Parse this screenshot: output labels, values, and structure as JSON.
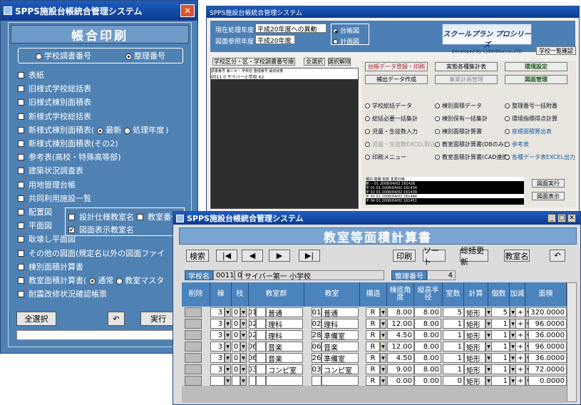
{
  "win1": {
    "title": "SPPS施設台帳統合管理システム",
    "heading": "帳合印刷",
    "radio": [
      {
        "label": "学校調書番号",
        "selected": false
      },
      {
        "label": "整理番号",
        "selected": true
      }
    ],
    "items": [
      "表紙",
      "旧様式学校総括表",
      "旧様式棟別面積表",
      "新様式学校総括表",
      "新様式棟別面積表(",
      "新様式棟別面積表(その2)",
      "参考表(高校・特殊高等部)",
      "建築状況調査表",
      "用地管理台帳",
      "共同利用施設一覧",
      "配置図",
      "平面図",
      "耿壊し平面図",
      "その他の図面(規定名以外の図面ファイ",
      "棟別面積計算書",
      "教室面積計算書(",
      "耐震改修状況確認帳票"
    ],
    "sub_radio": [
      {
        "label": "最新",
        "selected": true
      },
      {
        "label": "処理年度",
        "selected": false
      }
    ],
    "sub_radio2": [
      {
        "label": "通常",
        "selected": true
      },
      {
        "label": "教室マスタ",
        "selected": false
      }
    ],
    "popup": [
      "設計仕様教室名",
      "教室番号",
      "図面表示教室名"
    ],
    "buttons": {
      "select_all": "全選択",
      "undo": "↶",
      "run": "実行"
    }
  },
  "win2": {
    "title": "SPPS施設台帳統合管理システム",
    "year_label": "現在処理年度",
    "year_value": "平成20年度への異動",
    "ref_label": "図面参照年度",
    "ref_value": "平成20年度",
    "radio": [
      {
        "label": "台帳図",
        "selected": true
      },
      {
        "label": "計画図",
        "selected": false
      }
    ],
    "logo": "スクールプラン プロシリーズ",
    "logo_sub": "Developed By CyberBlue.co.,LTD",
    "school_list_btn": "学校一覧確認",
    "left_btns": [
      "学校区分・区・学校調書番号順",
      "全選択",
      "選択解除"
    ],
    "list_header": "調書番号 第二キー 学校名 整理番号 最初状態",
    "list_row": "0011 0 サイバー小学校 62",
    "top_btns": [
      "台帳データ登録・印刷",
      "実態各種集計表",
      "環境設定",
      "補出データ作成",
      "事業計画管理",
      "図面管理"
    ],
    "options": [
      "学校総括データ",
      "棟別面積データ",
      "整理番号一括附番",
      "総括必要一括集計",
      "棟別保有一括集計",
      "環境指標得点計算",
      "児童・生徒数入力",
      "棟別面積計算書",
      "座標面積算出表",
      "児童・生徒数EXCEL取込",
      "教室面積計算書(DBのみ)",
      "参考表",
      "印刷メニュー",
      "教室面積計算書(CAD連携)",
      "各種データ表EXCEL出力"
    ],
    "log_header": "種別 階種 枚数 変更日時",
    "log_rows": [
      "新 -- 01 2008/04/02 161426",
      "平 01 01 2008/04/02 161434",
      "平 02 01 2008/04/02 161439",
      "平 03 01 2008/04/02 161444",
      "平 04 01 2008/04/02 161451"
    ],
    "side_btns": [
      "図面実行",
      "図面表示"
    ]
  },
  "win3": {
    "title": "SPPS施設台帳統合管理システム",
    "heading": "教室等面積計算書",
    "toolbar": [
      "検索",
      "|◀",
      "◀",
      "▶",
      "▶|",
      "印刷",
      "ソート",
      "総括更新",
      "教室名",
      "↶"
    ],
    "school_label": "学校名",
    "school_code": "0011",
    "school_branch": "0",
    "school_name": "サイバー第一 小学校",
    "seiri_label": "整理番号",
    "seiri_value": "4",
    "headers": [
      "削除",
      "棟",
      "枝",
      "教室群",
      "教室",
      "構造",
      "棟底角度",
      "縦高半径",
      "室数",
      "計算",
      "個数",
      "加減",
      "面積"
    ],
    "rows": [
      [
        "3",
        "0",
        "01",
        "普通",
        "01",
        "普通",
        "R",
        "8.00",
        "8.00",
        "5",
        "矩形",
        "5",
        "+",
        "320.0000"
      ],
      [
        "3",
        "0",
        "02",
        "理科",
        "02",
        "理科",
        "R",
        "12.00",
        "8.00",
        "1",
        "矩形",
        "1",
        "+",
        "96.0000"
      ],
      [
        "3",
        "0",
        "02",
        "理科",
        "28",
        "準備室",
        "R",
        "4.50",
        "8.00",
        "1",
        "矩形",
        "1",
        "+",
        "36.0000"
      ],
      [
        "3",
        "0",
        "06",
        "音楽",
        "06",
        "音楽",
        "R",
        "12.00",
        "8.00",
        "1",
        "矩形",
        "1",
        "+",
        "96.0000"
      ],
      [
        "3",
        "0",
        "06",
        "音楽",
        "26",
        "準備室",
        "R",
        "4.50",
        "8.00",
        "1",
        "矩形",
        "1",
        "+",
        "36.0000"
      ],
      [
        "3",
        "0",
        "03",
        "コンピ室",
        "03",
        "コンピ室",
        "R",
        "9.00",
        "8.00",
        "1",
        "矩形",
        "1",
        "+",
        "72.0000"
      ],
      [
        "",
        "",
        "",
        "",
        "",
        "",
        "R",
        "0.00",
        "0.00",
        "0",
        "矩形",
        "1",
        "+",
        "0.0000"
      ]
    ]
  }
}
